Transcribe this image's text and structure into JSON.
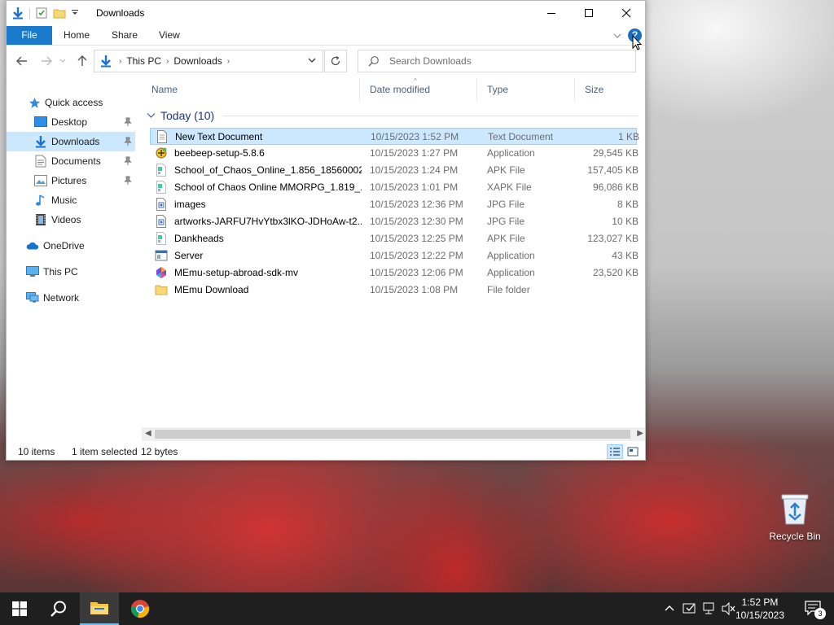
{
  "window": {
    "title": "Downloads",
    "ribbon_tabs": [
      "File",
      "Home",
      "Share",
      "View"
    ],
    "help_label": "?"
  },
  "navigation": {
    "breadcrumbs": [
      "This PC",
      "Downloads"
    ],
    "search_placeholder": "Search Downloads"
  },
  "sidebar": {
    "items": [
      {
        "label": "Quick access",
        "icon": "star-icon"
      },
      {
        "label": "Desktop",
        "icon": "desktop-folder-icon",
        "pinned": true
      },
      {
        "label": "Downloads",
        "icon": "downloads-folder-icon",
        "pinned": true,
        "selected": true
      },
      {
        "label": "Documents",
        "icon": "documents-folder-icon",
        "pinned": true
      },
      {
        "label": "Pictures",
        "icon": "pictures-folder-icon",
        "pinned": true
      },
      {
        "label": "Music",
        "icon": "music-folder-icon"
      },
      {
        "label": "Videos",
        "icon": "videos-folder-icon"
      },
      {
        "label": "OneDrive",
        "icon": "cloud-icon"
      },
      {
        "label": "This PC",
        "icon": "computer-icon"
      },
      {
        "label": "Network",
        "icon": "network-icon"
      }
    ]
  },
  "columns": {
    "name": "Name",
    "date": "Date modified",
    "type": "Type",
    "size": "Size"
  },
  "group": {
    "label": "Today (10)"
  },
  "files": [
    {
      "name": "New Text Document",
      "date": "10/15/2023 1:52 PM",
      "type": "Text Document",
      "size": "1 KB",
      "icon": "text-file-icon",
      "selected": true
    },
    {
      "name": "beebeep-setup-5.8.6",
      "date": "10/15/2023 1:27 PM",
      "type": "Application",
      "size": "29,545 KB",
      "icon": "installer-icon"
    },
    {
      "name": "School_of_Chaos_Online_1.856_18560002...",
      "date": "10/15/2023 1:24 PM",
      "type": "APK File",
      "size": "157,405 KB",
      "icon": "apk-file-icon"
    },
    {
      "name": "School of Chaos Online MMORPG_1.819_...",
      "date": "10/15/2023 1:01 PM",
      "type": "XAPK File",
      "size": "96,086 KB",
      "icon": "apk-file-icon"
    },
    {
      "name": "images",
      "date": "10/15/2023 12:36 PM",
      "type": "JPG File",
      "size": "8 KB",
      "icon": "image-file-icon"
    },
    {
      "name": "artworks-JARFU7HvYtbx3lKO-JDHoAw-t2...",
      "date": "10/15/2023 12:30 PM",
      "type": "JPG File",
      "size": "10 KB",
      "icon": "image-file-icon"
    },
    {
      "name": "Dankheads",
      "date": "10/15/2023 12:25 PM",
      "type": "APK File",
      "size": "123,027 KB",
      "icon": "apk-file-icon"
    },
    {
      "name": "Server",
      "date": "10/15/2023 12:22 PM",
      "type": "Application",
      "size": "43 KB",
      "icon": "application-icon"
    },
    {
      "name": "MEmu-setup-abroad-sdk-mv",
      "date": "10/15/2023 12:06 PM",
      "type": "Application",
      "size": "23,520 KB",
      "icon": "memu-app-icon"
    },
    {
      "name": "MEmu Download",
      "date": "10/15/2023 1:08 PM",
      "type": "File folder",
      "size": "",
      "icon": "folder-icon"
    }
  ],
  "status": {
    "items": "10 items",
    "selected": "1 item selected",
    "size": "12 bytes"
  },
  "desktop": {
    "recycle_bin_label": "Recycle Bin"
  },
  "taskbar": {
    "time": "1:52 PM",
    "date": "10/15/2023",
    "notification_count": "3"
  },
  "colors": {
    "accent": "#1979ca",
    "selection": "#cce8ff",
    "group_header": "#1e3287"
  }
}
